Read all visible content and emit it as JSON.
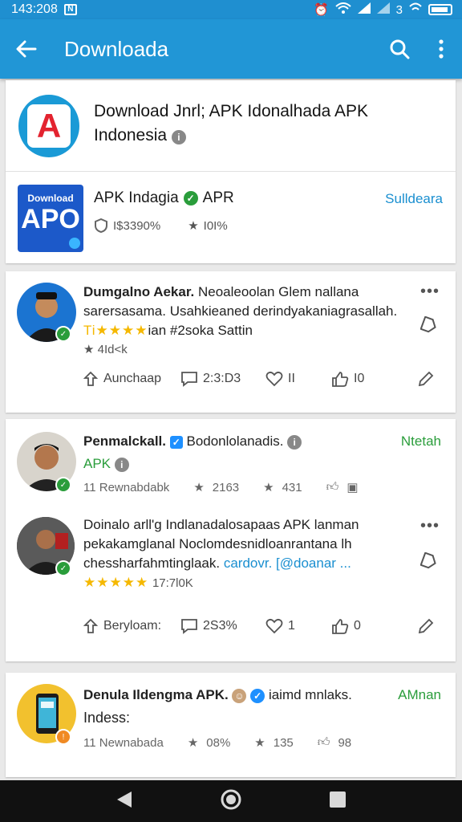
{
  "status": {
    "time": "143:208",
    "carrier": "3"
  },
  "appbar": {
    "title": "Downloada"
  },
  "app_card": {
    "title": "Download Jnrl; APK Idonalhada APK Indonesia",
    "logo_letter": "A",
    "item": {
      "logo_line1": "Download",
      "logo_line2": "APO",
      "name": "APK Indagia",
      "tag": "APR",
      "action": "Sulldeara",
      "stat1": "I$3390%",
      "stat2": "I0I%"
    }
  },
  "posts": [
    {
      "author": "Dumgalno Aekar.",
      "text1": "Neoaleoolan Glem nallana",
      "text2": "sarersasama. Usahkieaned derindyakaniagrasallah.",
      "stars": "Ti★★★★",
      "rating_text": "ian #2soka Sattin",
      "small": "★ 4Id<k",
      "share": "Aunchaap",
      "comments": "2:3:D3",
      "likes1": "II",
      "likes2": "I0"
    },
    {
      "author": "Penmalckall.",
      "author2": "Bodonlolanadis.",
      "tag": "APK",
      "action": "Ntetah",
      "downloads": "11 Rewnabdabk",
      "stat1": "2163",
      "stat2": "431",
      "reply_text1": "Doinalo arll'g Indlanadalosapaas APK lanman",
      "reply_text2": "pekakamglanal Noclomdesnidloanrantana lh",
      "reply_text3": "chessharfahmtinglaak.",
      "reply_link": "cardovr. [@doanar ...",
      "reply_stars": "★★★★★",
      "reply_rating": "17:7l0K",
      "share": "Beryloam:",
      "comments": "2S3%",
      "likes1": "1",
      "likes2": "0"
    },
    {
      "author": "Denula Ildengma APK.",
      "author2": "iaimd mnlaks.",
      "action": "AMnan",
      "line2": "Indess:",
      "downloads": "11 Newnabada",
      "stat1": "08%",
      "stat2": "135",
      "stat3": "98"
    }
  ]
}
